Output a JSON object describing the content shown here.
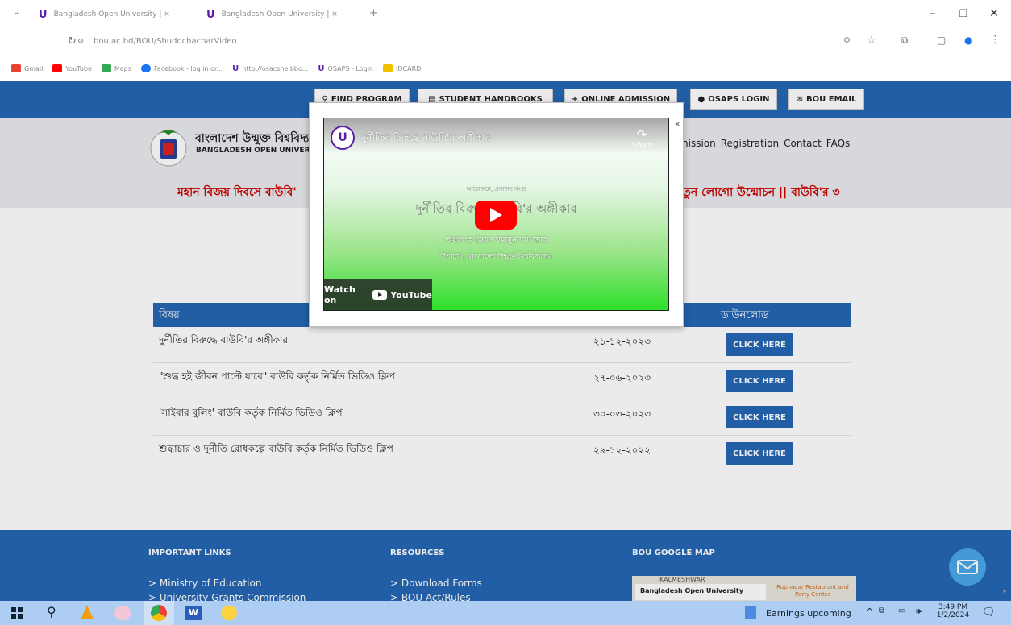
{
  "browser": {
    "tabs": [
      {
        "title": "Bangladesh Open University | ×",
        "active": false
      },
      {
        "title": "Bangladesh Open University | ×",
        "active": true
      }
    ],
    "url": "bou.ac.bd/BOU/ShudochacharVideo",
    "bookmarks": [
      {
        "label": "Gmail",
        "color": "#ea4335"
      },
      {
        "label": "YouTube",
        "color": "#ff0000"
      },
      {
        "label": "Maps",
        "color": "#34a853"
      },
      {
        "label": "Facebook - log in or...",
        "color": "#1877f2"
      },
      {
        "label": "http://osacsne.bbo...",
        "color": "#5a1fa8"
      },
      {
        "label": "OSAPS - Login",
        "color": "#5a1fa8"
      },
      {
        "label": "IDCARD",
        "color": "#f2c200"
      }
    ]
  },
  "topnav": {
    "buttons": [
      {
        "icon": "search-icon",
        "label": "FIND PROGRAM"
      },
      {
        "icon": "book-icon",
        "label": "STUDENT HANDBOOKS"
      },
      {
        "icon": "plus-icon",
        "label": "ONLINE ADMISSION"
      },
      {
        "icon": "user-icon",
        "label": "OSAPS LOGIN"
      },
      {
        "icon": "envelope-icon",
        "label": "BOU EMAIL"
      }
    ]
  },
  "header": {
    "name_bn": "বাংলাদেশ উন্মুক্ত বিশ্ববিদ্যাল",
    "name_en": "BANGLADESH OPEN UNIVERSIT",
    "menu": [
      "nission",
      "Registration",
      "Contact",
      "FAQs"
    ]
  },
  "marquee": {
    "left": "মহান বিজয় দিবসে বাউবি'",
    "right": "নতুন লোগো উন্মোচন   ||  বাউবি'র ৩"
  },
  "table": {
    "headers": {
      "subject": "বিষয়",
      "download": "ডাউনলোড"
    },
    "rows": [
      {
        "subject": "দুর্নীতির বিরুদ্ধে বাউবি'র অঙ্গীকার",
        "date": "২১-১২-২০২৩",
        "action": "CLICK HERE"
      },
      {
        "subject": "\"শুদ্ধ হই জীবন পাল্টে যাবে\" বাউবি কর্তৃক নির্মিত ভিডিও ক্লিপ",
        "date": "২৭-০৬-২০২৩",
        "action": "CLICK HERE"
      },
      {
        "subject": "'সাইবার বুলিং' বাউবি কর্তৃক নির্মিত ভিডিও ক্লিপ",
        "date": "৩০-০৩-২০২৩",
        "action": "CLICK HERE"
      },
      {
        "subject": "শুদ্ধাচার ও দুর্নীতি রোধকল্পে বাউবি কর্তৃক নির্মিত ভিডিও ক্লিপ",
        "date": "২৯-১২-২০২২",
        "action": "CLICK HERE"
      }
    ]
  },
  "footer": {
    "important_links": {
      "heading": "IMPORTANT LINKS",
      "items": [
        "> Ministry of Education",
        "> University Grants Commission"
      ]
    },
    "resources": {
      "heading": "RESOURCES",
      "items": [
        "> Download Forms",
        "> BOU Act/Rules"
      ]
    },
    "map": {
      "heading": "BOU GOOGLE MAP",
      "area": "KALMESHWAR",
      "place": "Bangladesh Open University",
      "poi": "Rupnagar Restaurant and Party Center"
    }
  },
  "modal": {
    "video_title": "দুর্নীতির বিরুদ্ধে বাউবি'র অঙ্গীকার",
    "share_label": "Share",
    "slide_small": "আয়োজনে, প্রকাশনা সংস্থা",
    "slide_title": "দুর্নীতির বিরুদ্ধে বাউবি'র অঙ্গীকার",
    "slide_line1": "অধ্যাপক সৈয়দ হুমায়ুন আখতার",
    "slide_line2": "উপাচার্য, বাংলাদেশ উন্মুক্ত বিশ্ববিদ্যালয়",
    "watch_on": "Watch on",
    "youtube": "YouTube",
    "close": "×"
  },
  "taskbar": {
    "news": "Earnings upcoming",
    "time": "3:49 PM",
    "date": "1/2/2024"
  },
  "colors": {
    "brand_blue": "#2567b4",
    "marquee_red": "#cc0000",
    "youtube_red": "#ff0000"
  }
}
